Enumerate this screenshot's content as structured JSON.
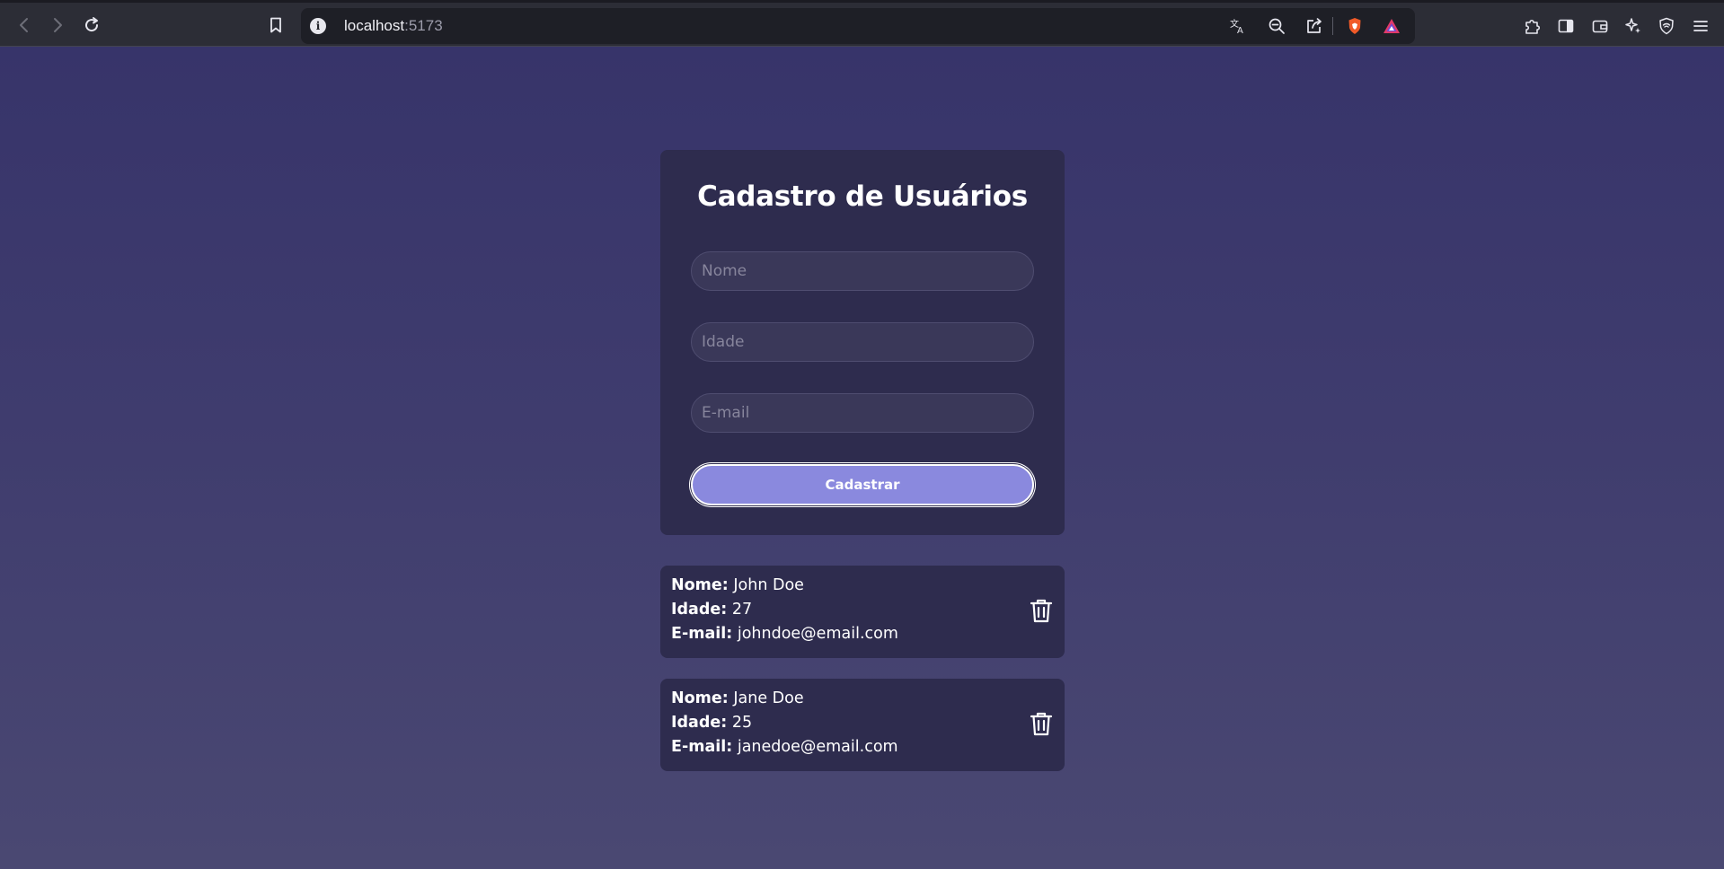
{
  "browser": {
    "url_host": "localhost",
    "url_port": ":5173",
    "icons": [
      "back-icon",
      "forward-icon",
      "reload-icon",
      "bookmark-icon",
      "site-info-icon",
      "translate-icon",
      "zoom-out-icon",
      "share-icon",
      "brave-shields-icon",
      "brave-rewards-icon",
      "extensions-icon",
      "sidebar-icon",
      "wallet-icon",
      "leo-ai-icon",
      "vpn-icon",
      "menu-icon"
    ]
  },
  "form": {
    "title": "Cadastro de Usuários",
    "name_placeholder": "Nome",
    "age_placeholder": "Idade",
    "email_placeholder": "E-mail",
    "submit_label": "Cadastrar"
  },
  "users": [
    {
      "name_label": "Nome:",
      "name": "John Doe",
      "age_label": "Idade:",
      "age": "27",
      "email_label": "E-mail:",
      "email": "johndoe@email.com"
    },
    {
      "name_label": "Nome:",
      "name": "Jane Doe",
      "age_label": "Idade:",
      "age": "25",
      "email_label": "E-mail:",
      "email": "janedoe@email.com"
    }
  ],
  "colors": {
    "page_top": "#37346a",
    "page_bottom": "#4a4872",
    "card": "#2e2c4e",
    "button": "#8a89de"
  }
}
